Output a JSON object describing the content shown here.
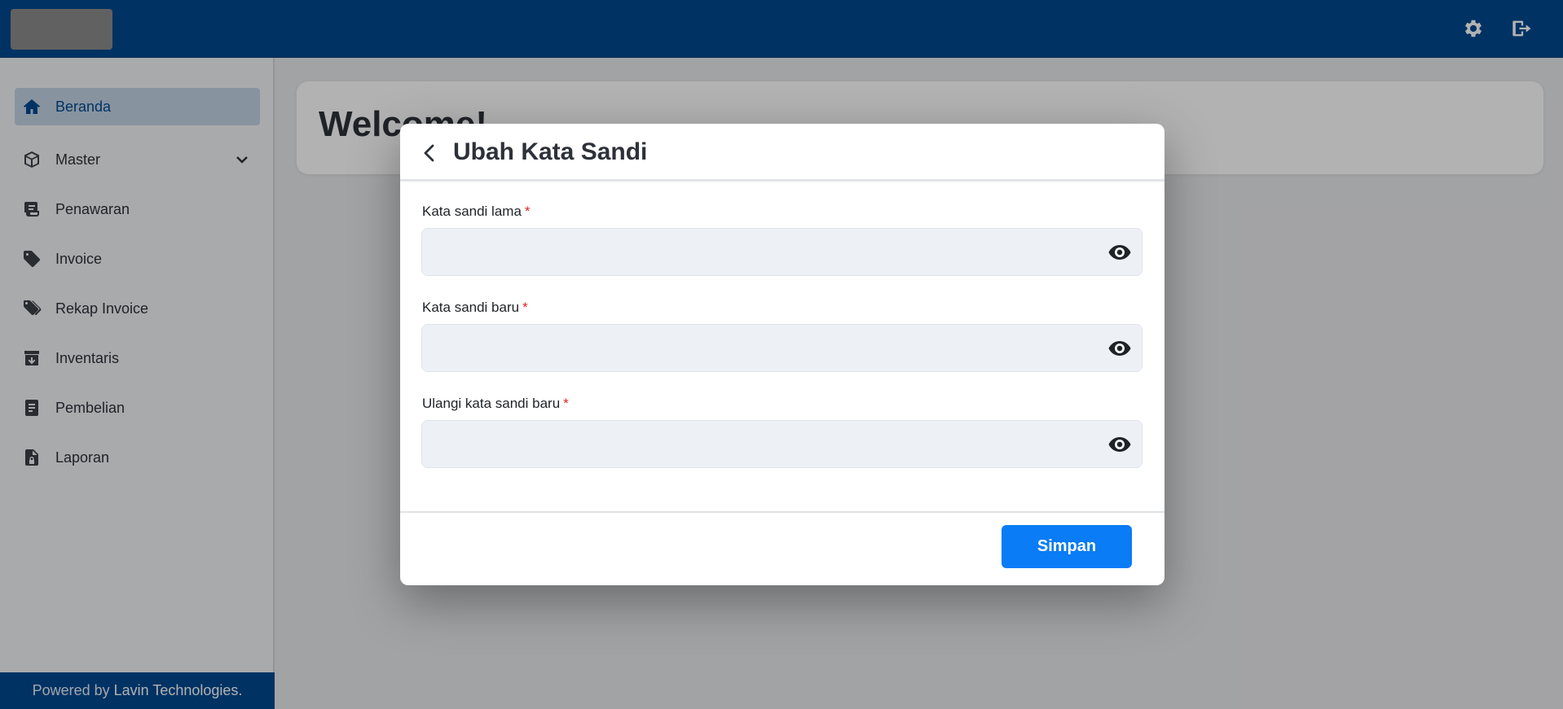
{
  "topbar": {
    "background": "#00488f",
    "icons": [
      "gear-icon",
      "logout-icon"
    ]
  },
  "sidebar": {
    "items": [
      {
        "label": "Beranda",
        "icon": "home-icon",
        "active": true
      },
      {
        "label": "Master",
        "icon": "box-icon",
        "expandable": true
      },
      {
        "label": "Penawaran",
        "icon": "quote-icon"
      },
      {
        "label": "Invoice",
        "icon": "tag-icon"
      },
      {
        "label": "Rekap Invoice",
        "icon": "tags-icon"
      },
      {
        "label": "Inventaris",
        "icon": "archive-icon"
      },
      {
        "label": "Pembelian",
        "icon": "document-icon"
      },
      {
        "label": "Laporan",
        "icon": "file-lock-icon"
      }
    ],
    "footer_prefix": "Powered by",
    "footer_brand": "Lavin Technologies."
  },
  "main": {
    "welcome_title": "Welcome!"
  },
  "modal": {
    "title": "Ubah Kata Sandi",
    "required_marker": "*",
    "fields": [
      {
        "label": "Kata sandi lama",
        "value": "",
        "icon": "eye-icon"
      },
      {
        "label": "Kata sandi baru",
        "value": "",
        "icon": "eye-icon"
      },
      {
        "label": "Ulangi kata sandi baru",
        "value": "",
        "icon": "eye-icon"
      }
    ],
    "save_label": "Simpan"
  },
  "colors": {
    "brand": "#00488f",
    "accent": "#0a7cf5",
    "required": "#e02424"
  }
}
